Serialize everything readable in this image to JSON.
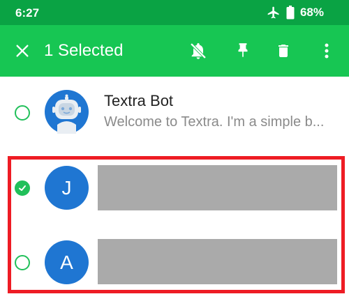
{
  "status": {
    "time": "6:27",
    "battery": "68%",
    "icons": [
      "airplane-icon",
      "battery-icon"
    ]
  },
  "toolbar": {
    "selected_label": "1 Selected",
    "icons": [
      "close-icon",
      "mute-icon",
      "pin-icon",
      "delete-icon",
      "more-vert-icon"
    ]
  },
  "conversations": [
    {
      "name": "Textra Bot",
      "snippet": "Welcome to Textra. I'm a simple b...",
      "avatar": "robot-avatar-icon",
      "selected": false
    },
    {
      "initial": "J",
      "selected": true,
      "content": "redacted"
    },
    {
      "initial": "A",
      "selected": false,
      "content": "redacted"
    }
  ],
  "colors": {
    "status_bar": "#0aa344",
    "toolbar": "#17c653",
    "accent": "#21c05a",
    "avatar": "#1f76d2",
    "redaction": "#aaaaaa",
    "highlight": "#ee1c24"
  }
}
